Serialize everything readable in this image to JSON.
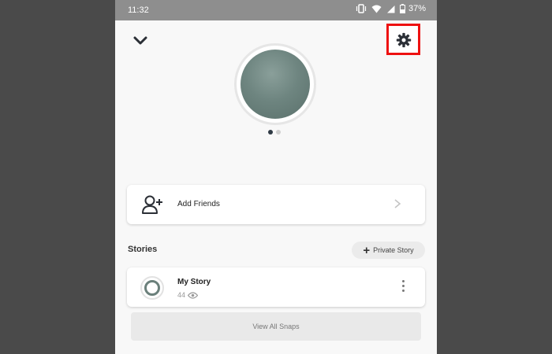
{
  "status_bar": {
    "time": "11:32",
    "battery": "37%"
  },
  "header": {
    "collapse_icon": "chevron-down-icon",
    "settings_icon": "gear-icon",
    "highlight_color": "#ee1111"
  },
  "profile": {
    "pager_dots": 2,
    "active_dot": 0
  },
  "add_friends": {
    "label": "Add Friends",
    "icon": "add-friend-icon"
  },
  "stories": {
    "title": "Stories",
    "private_story_label": "Private Story",
    "my_story": {
      "label": "My Story",
      "views": "44"
    },
    "view_all_label": "View All Snaps"
  }
}
